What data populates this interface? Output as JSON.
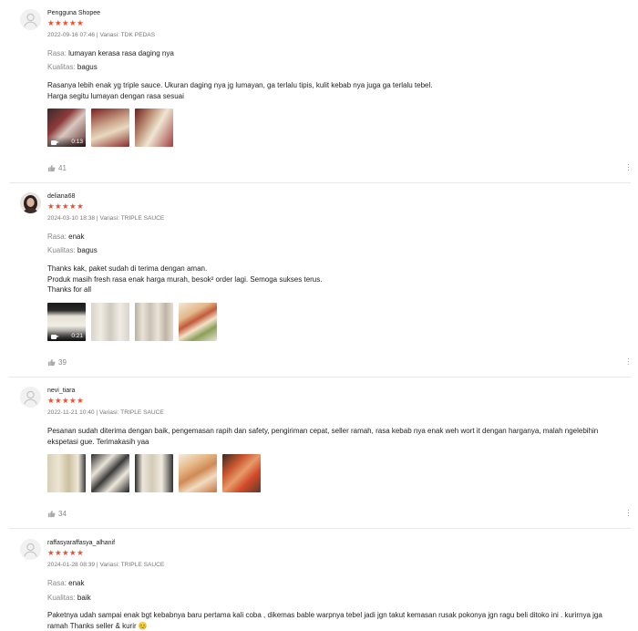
{
  "reviews": [
    {
      "username": "Pengguna Shopee",
      "stars": "★★★★★",
      "date": "2022-09-16 07:46",
      "variant_sep": " | Variasi: ",
      "variant": "TDK PEDAS",
      "attributes": [
        {
          "key": "Rasa:",
          "value": "lumayan kerasa rasa daging nya"
        },
        {
          "key": "Kualitas:",
          "value": "bagus"
        }
      ],
      "body": [
        "Rasanya lebih enak yg triple sauce. Ukuran daging nya jg lumayan, ga terlalu tipis, kulit kebab nya juga ga terlalu tebel.",
        "Harga segitu lumayan dengan rasa sesuai"
      ],
      "video_duration": "0:13",
      "likes": "41"
    },
    {
      "username": "deliana68",
      "stars": "★★★★★",
      "date": "2024-03-10 18:38",
      "variant_sep": " | Variasi: ",
      "variant": "TRIPLE SAUCE",
      "attributes": [
        {
          "key": "Rasa:",
          "value": "enak"
        },
        {
          "key": "Kualitas:",
          "value": "bagus"
        }
      ],
      "body": [
        "Thanks kak, paket sudah di terima dengan aman.",
        "Produk masih fresh rasa enak harga murah, besok² order lagi. Semoga sukses terus.",
        "Thanks for all"
      ],
      "video_duration": "0:21",
      "likes": "39"
    },
    {
      "username": "nevi_tiara",
      "stars": "★★★★★",
      "date": "2022-11-21 10:40",
      "variant_sep": " | Variasi: ",
      "variant": "TRIPLE SAUCE",
      "attributes": [],
      "body": [
        "Pesanan sudah diterima dengan baik, pengemasan rapih dan safety, pengiriman cepat, seller ramah, rasa kebab nya enak weh wort it dengan harganya, malah ngelebihin",
        "ekspetasi gue. Terimakasih yaa"
      ],
      "likes": "34"
    },
    {
      "username": "raffasyaraffasya_alhanif",
      "stars": "★★★★★",
      "date": "2024-01-28 08:39",
      "variant_sep": " | Variasi: ",
      "variant": "TRIPLE SAUCE",
      "attributes": [
        {
          "key": "Rasa:",
          "value": "enak"
        },
        {
          "key": "Kualitas:",
          "value": "baik"
        }
      ],
      "body": [
        "Paketnya udah sampai enak bgt kebabnya baru pertama kali coba , dikemas bable warpnya tebel jadi jgn takut kemasan rusak pokonya jgn ragu beli ditoko ini . kurirnya jga",
        "ramah Thanks seller & kurir 😊"
      ]
    }
  ],
  "icons": {
    "like": "thumbs-up-icon",
    "more": "more-vertical-icon",
    "avatar": "default-avatar-icon",
    "video": "video-camera-icon"
  },
  "colors": {
    "star": "#ee4d2d",
    "meta": "#777777",
    "divider": "#e8e8e8"
  }
}
